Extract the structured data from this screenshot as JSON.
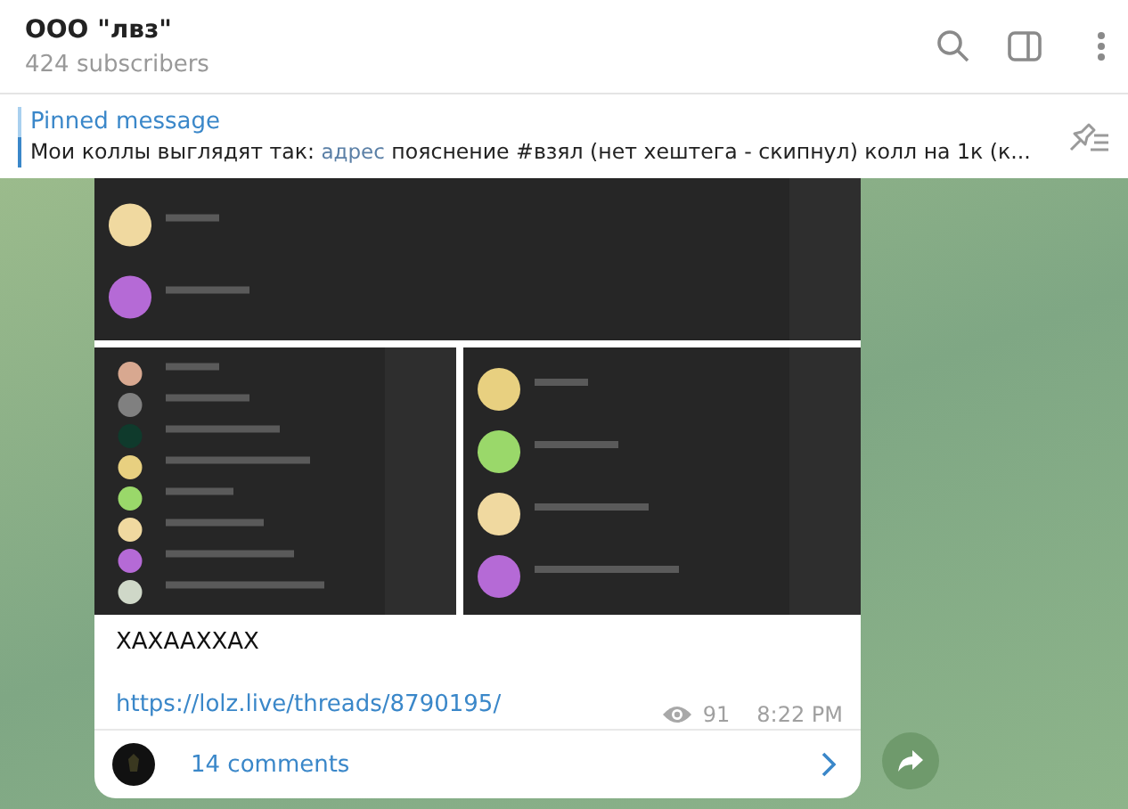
{
  "header": {
    "title": "ООО \"лвз\"",
    "subtitle": "424 subscribers"
  },
  "pinned": {
    "label": "Pinned message",
    "segments": [
      {
        "kind": "text",
        "text": "Мои коллы выглядят так: "
      },
      {
        "kind": "code",
        "text": "адрес"
      },
      {
        "kind": "text",
        "text": " пояснение  #взял (нет хештега - скипнул)   колл на 1к (к..."
      }
    ]
  },
  "message": {
    "text": "XAXAAXXAX",
    "link": "https://lolz.live/threads/8790195/",
    "views": "91",
    "time": "8:22 PM",
    "comments": "14 comments"
  }
}
